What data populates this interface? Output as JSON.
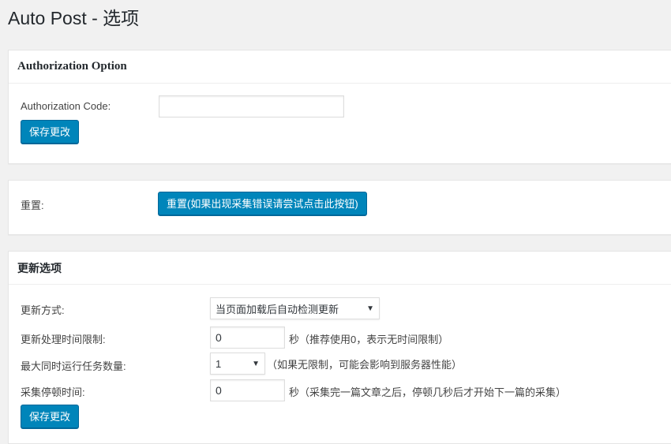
{
  "page": {
    "title": "Auto Post - 选项"
  },
  "authorization": {
    "heading": "Authorization Option",
    "code_label": "Authorization Code:",
    "code_value": "",
    "save_label": "保存更改"
  },
  "reset": {
    "label": "重置:",
    "button_label": "重置(如果出现采集错误请尝试点击此按钮)"
  },
  "update": {
    "heading": "更新选项",
    "method_label": "更新方式:",
    "method_value": "当页面加载后自动检测更新",
    "time_limit_label": "更新处理时间限制:",
    "time_limit_value": "0",
    "time_limit_hint": "秒（推荐使用0，表示无时间限制）",
    "max_tasks_label": "最大同时运行任务数量:",
    "max_tasks_value": "1",
    "max_tasks_hint": "（如果无限制，可能会影响到服务器性能）",
    "pause_label": "采集停顿时间:",
    "pause_value": "0",
    "pause_hint": "秒（采集完一篇文章之后，停顿几秒后才开始下一篇的采集）",
    "save_label": "保存更改"
  },
  "icons": {
    "dropdown": "▼"
  }
}
